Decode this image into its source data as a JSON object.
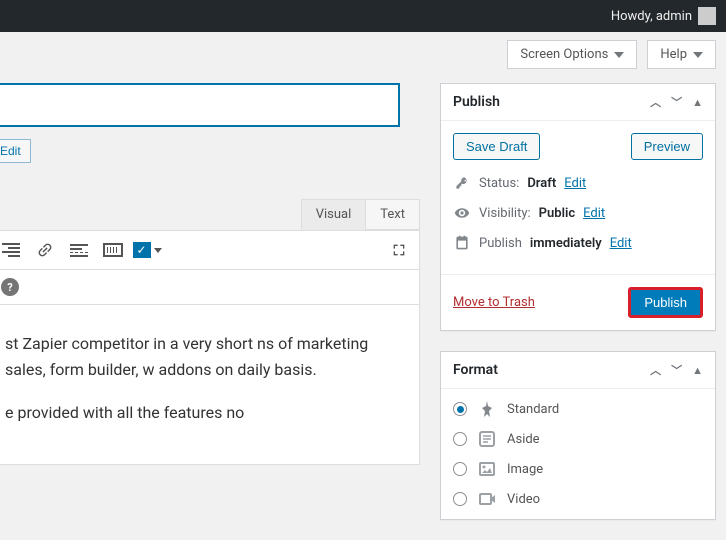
{
  "adminbar": {
    "greeting": "Howdy, admin"
  },
  "topbar": {
    "screen_options": "Screen Options",
    "help": "Help"
  },
  "permalink": {
    "edit": "Edit"
  },
  "editor": {
    "tabs": {
      "visual": "Visual",
      "text": "Text"
    },
    "body_p1": "st Zapier competitor in a very short ns of marketing sales, form builder, w addons on daily basis.",
    "body_p2": "e provided with all the features no"
  },
  "publish": {
    "title": "Publish",
    "save_draft": "Save Draft",
    "preview": "Preview",
    "status_label": "Status:",
    "status_value": "Draft",
    "visibility_label": "Visibility:",
    "visibility_value": "Public",
    "publish_label": "Publish",
    "publish_when": "immediately",
    "edit": "Edit",
    "trash": "Move to Trash",
    "button": "Publish"
  },
  "format": {
    "title": "Format",
    "options": {
      "standard": "Standard",
      "aside": "Aside",
      "image": "Image",
      "video": "Video"
    }
  }
}
